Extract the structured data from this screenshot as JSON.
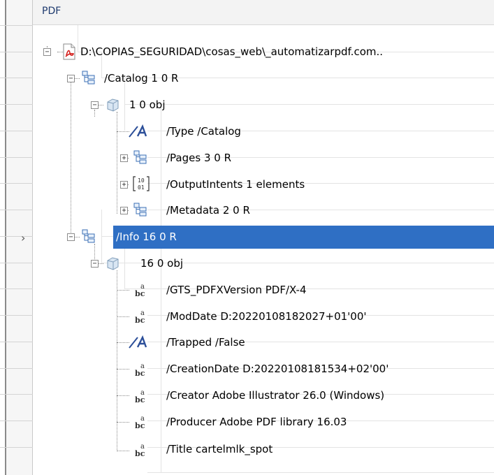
{
  "header": {
    "title": "PDF"
  },
  "tree": {
    "root": {
      "label": "D:\\COPIAS_SEGURIDAD\\cosas_web\\_automatizarpdf.com..",
      "icon": "pdf-file-icon"
    },
    "catalog": {
      "label": "/Catalog 1 0 R",
      "icon": "structure-icon"
    },
    "catalog_obj": {
      "label": "1 0 obj",
      "icon": "cube-icon"
    },
    "type": {
      "label": "/Type /Catalog",
      "icon": "name-icon"
    },
    "pages": {
      "label": "/Pages 3 0 R",
      "icon": "structure-icon"
    },
    "output_intents": {
      "label": "/OutputIntents 1 elements",
      "icon": "array-icon"
    },
    "metadata": {
      "label": "/Metadata 2 0 R",
      "icon": "structure-icon"
    },
    "info": {
      "label": "/Info 16 0 R",
      "icon": "structure-icon",
      "selected": true
    },
    "info_obj": {
      "label": "16 0 obj",
      "icon": "cube-icon"
    },
    "gts": {
      "label": "/GTS_PDFXVersion PDF/X-4",
      "icon": "string-icon"
    },
    "moddate": {
      "label": "/ModDate D:20220108182027+01'00'",
      "icon": "string-icon"
    },
    "trapped": {
      "label": "/Trapped /False",
      "icon": "name-icon"
    },
    "creationdate": {
      "label": "/CreationDate D:20220108181534+02'00'",
      "icon": "string-icon"
    },
    "creator": {
      "label": "/Creator Adobe Illustrator 26.0 (Windows)",
      "icon": "string-icon"
    },
    "producer": {
      "label": "/Producer Adobe PDF library 16.03",
      "icon": "string-icon"
    },
    "title": {
      "label": "/Title cartelmlk_spot",
      "icon": "string-icon"
    }
  },
  "colors": {
    "selection": "#2f6fc4",
    "header_text": "#1e3a6e"
  }
}
